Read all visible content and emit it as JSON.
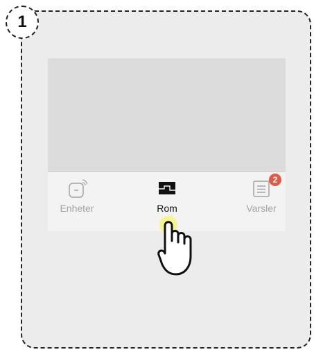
{
  "step": {
    "number": "1"
  },
  "tabs": [
    {
      "label": "Enheter",
      "icon": "devices-icon",
      "active": false
    },
    {
      "label": "Rom",
      "icon": "room-icon",
      "active": true
    },
    {
      "label": "Varsler",
      "icon": "notifications-icon",
      "active": false,
      "badge": "2"
    }
  ],
  "colors": {
    "badge": "#e05a47",
    "active": "#111111",
    "inactive": "#a3a3a3",
    "tap_highlight": "#f4f57a"
  }
}
